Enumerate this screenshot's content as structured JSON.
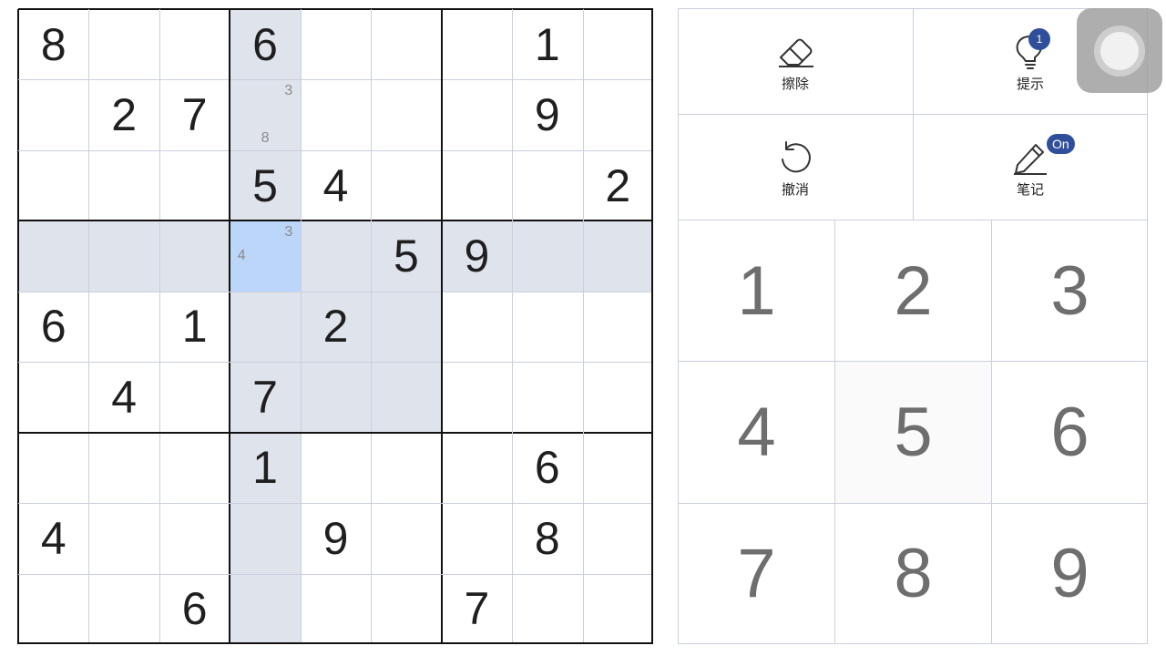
{
  "board": {
    "givens": [
      [
        "8",
        "",
        "",
        "6",
        "",
        "",
        "",
        "1",
        ""
      ],
      [
        "",
        "2",
        "7",
        "",
        "",
        "",
        "",
        "9",
        ""
      ],
      [
        "",
        "",
        "",
        "5",
        "4",
        "",
        "",
        "",
        "2"
      ],
      [
        "",
        "",
        "",
        "",
        "",
        "5",
        "9",
        "",
        ""
      ],
      [
        "6",
        "",
        "1",
        "",
        "2",
        "",
        "",
        "",
        ""
      ],
      [
        "",
        "4",
        "",
        "7",
        "",
        "",
        "",
        "",
        ""
      ],
      [
        "",
        "",
        "",
        "1",
        "",
        "",
        "",
        "6",
        ""
      ],
      [
        "4",
        "",
        "",
        "",
        "9",
        "",
        "",
        "8",
        ""
      ],
      [
        "",
        "",
        "6",
        "",
        "",
        "",
        "7",
        "",
        ""
      ]
    ],
    "notes": [
      {
        "r": 1,
        "c": 3,
        "values": [
          "3",
          "8"
        ]
      },
      {
        "r": 3,
        "c": 3,
        "values": [
          "3",
          "4"
        ]
      }
    ],
    "selected": {
      "r": 3,
      "c": 3
    }
  },
  "toolbar": {
    "erase": {
      "label": "擦除",
      "icon": "eraser-icon"
    },
    "hint": {
      "label": "提示",
      "icon": "lightbulb-icon",
      "badge": "1"
    },
    "undo": {
      "label": "撤消",
      "icon": "undo-icon"
    },
    "notes": {
      "label": "笔记",
      "icon": "pencil-icon",
      "badge": "On"
    }
  },
  "keypad": [
    "1",
    "2",
    "3",
    "4",
    "5",
    "6",
    "7",
    "8",
    "9"
  ],
  "colors": {
    "accent": "#2f4f9b",
    "highlight": "#dfe3ec",
    "selected": "#bcd6fa",
    "grid_thin": "#c9cfdc",
    "grid_thick": "#111111"
  }
}
